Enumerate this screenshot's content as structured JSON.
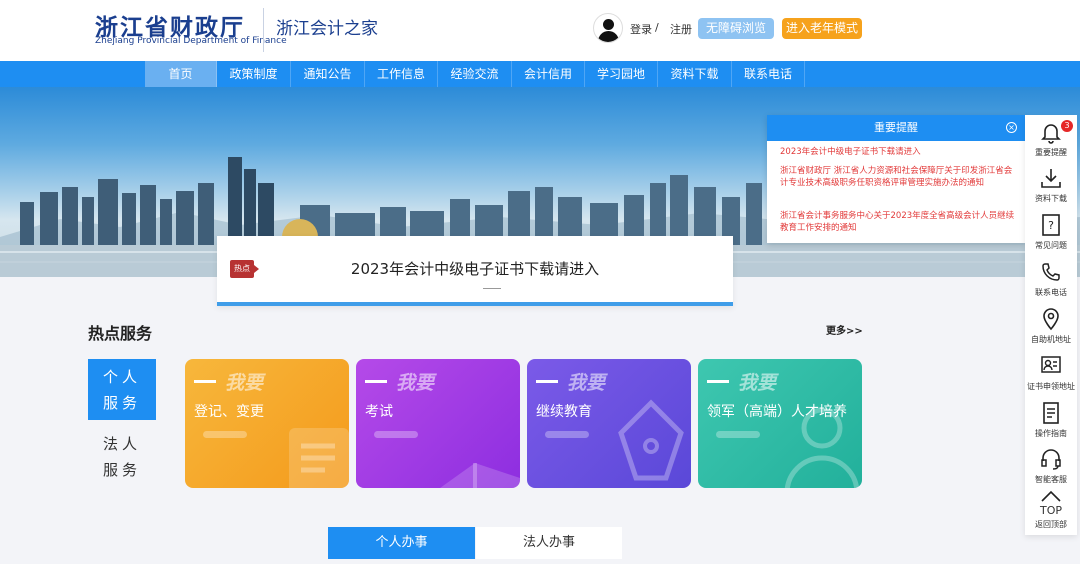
{
  "header": {
    "logo_cn": "浙江省财政厅",
    "logo_en": "Zhejiang Provincial Department of Finance",
    "site_name": "浙江会计之家",
    "login": "登录",
    "separator": "/",
    "register": "注册",
    "accessible_btn": "无障碍浏览",
    "elder_btn": "进入老年模式"
  },
  "nav": {
    "items": [
      "首页",
      "政策制度",
      "通知公告",
      "工作信息",
      "经验交流",
      "会计信用",
      "学习园地",
      "资料下载",
      "联系电话"
    ]
  },
  "hot": {
    "tag": "热点",
    "text": "2023年会计中级电子证书下载请进入"
  },
  "notice": {
    "title": "重要提醒",
    "items": [
      "2023年会计中级电子证书下载请进入",
      "浙江省财政厅 浙江省人力资源和社会保障厅关于印发浙江省会计专业技术高级职务任职资格评审管理实施办法的通知",
      "浙江省会计事务服务中心关于2023年度全省高级会计人员继续教育工作安排的通知"
    ]
  },
  "sidebar": {
    "badge": "3",
    "items": [
      "重要提醒",
      "资料下载",
      "常见问题",
      "联系电话",
      "自助机地址",
      "证书申领地址",
      "操作指南",
      "智能客服"
    ],
    "top_label": "TOP",
    "top_sub": "返回顶部"
  },
  "services": {
    "title": "热点服务",
    "more": "更多>>",
    "tab_personal": [
      "个人",
      "服务"
    ],
    "tab_corp": [
      "法人",
      "服务"
    ],
    "cards": [
      {
        "big": "我要",
        "name": "登记、变更"
      },
      {
        "big": "我要",
        "name": "考试"
      },
      {
        "big": "我要",
        "name": "继续教育"
      },
      {
        "big": "我要",
        "name": "领军（高端）人才培养"
      }
    ]
  },
  "bottom_tabs": [
    "个人办事",
    "法人办事"
  ],
  "colors": {
    "primary": "#1e8ef2",
    "elder": "#f6a21c",
    "notice_text": "#e23a3a",
    "card_orange": "#f7a824",
    "card_purple": "#a237e0",
    "card_indigo": "#6a55e0",
    "card_teal": "#2cbfa5"
  }
}
